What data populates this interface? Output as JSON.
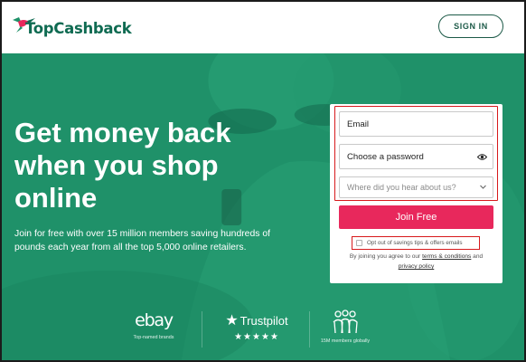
{
  "header": {
    "logo_text": "TopCashback",
    "sign_in_label": "SIGN IN"
  },
  "hero": {
    "headline": "Get money back when you shop online",
    "subtext": "Join for free with over 15 million members saving hundreds of pounds each year from all the top 5,000 online retailers."
  },
  "form": {
    "email_placeholder": "Email",
    "password_placeholder": "Choose a password",
    "source_placeholder": "Where did you hear about us?",
    "join_label": "Join Free",
    "optout_label": "Opt out of savings tips & offers emails",
    "terms_prefix": "By joining you agree to our ",
    "terms_link": "terms & conditions",
    "terms_and": " and",
    "privacy_link": "privacy policy"
  },
  "trust": {
    "ebay_logo": "ebay",
    "ebay_caption": "Top-named brands",
    "trustpilot_logo": "Trustpilot",
    "trustpilot_stars": "★★★★★",
    "members_caption": "15M members globally"
  },
  "icons": {
    "logo": "hummingbird-logo-icon",
    "password": "eye-icon",
    "select": "chevron-down-icon",
    "trustpilot": "star-icon",
    "members": "people-icon"
  },
  "colors": {
    "brand_green": "#1f9169",
    "logo_green": "#0f6b52",
    "join_pink": "#e8285c",
    "highlight_red": "#d7191c"
  }
}
